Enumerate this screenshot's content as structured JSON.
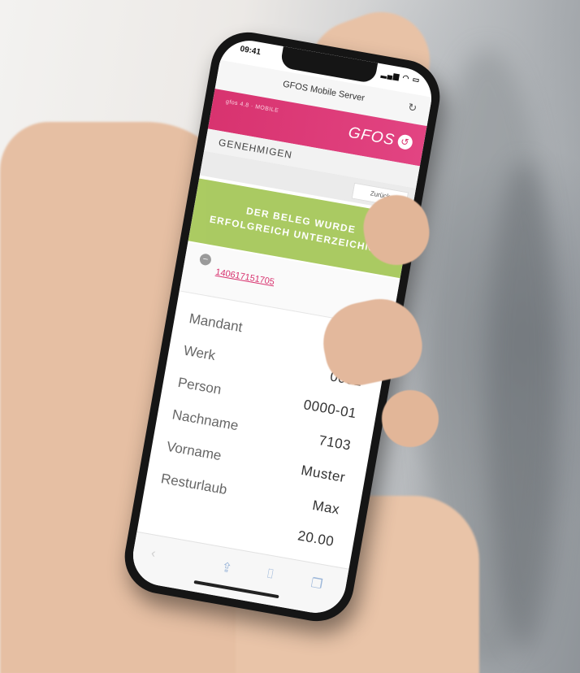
{
  "status_bar": {
    "time": "09:41",
    "icons": "signal-wifi-battery"
  },
  "browser": {
    "page_title": "GFOS Mobile Server",
    "reload_icon": "reload-icon"
  },
  "brand": {
    "version": "gfos 4.8 · MOBILE",
    "logo": "GFOS",
    "color": "#d8336f"
  },
  "section": {
    "title": "GENEHMIGEN"
  },
  "nav": {
    "back_label": "Zurück"
  },
  "toast": {
    "line1": "DER BELEG WURDE",
    "line2": "ERFOLGREICH UNTERZEICHNET",
    "color": "#a6c85a"
  },
  "document": {
    "number": "140617151705"
  },
  "details": {
    "rows": [
      {
        "label": "Mandant",
        "value": ""
      },
      {
        "label": "Werk",
        "value": "0001"
      },
      {
        "label": "Person",
        "value": "0000-01"
      },
      {
        "label": "Nachname",
        "value": "7103"
      },
      {
        "label": "Vorname",
        "value": "Muster"
      },
      {
        "label": "Resturlaub",
        "value": "Max"
      },
      {
        "label": "",
        "value": "20.00"
      }
    ]
  },
  "toolbar": {
    "icons": [
      "back-icon",
      "share-icon",
      "bookmarks-icon",
      "tabs-icon"
    ]
  }
}
